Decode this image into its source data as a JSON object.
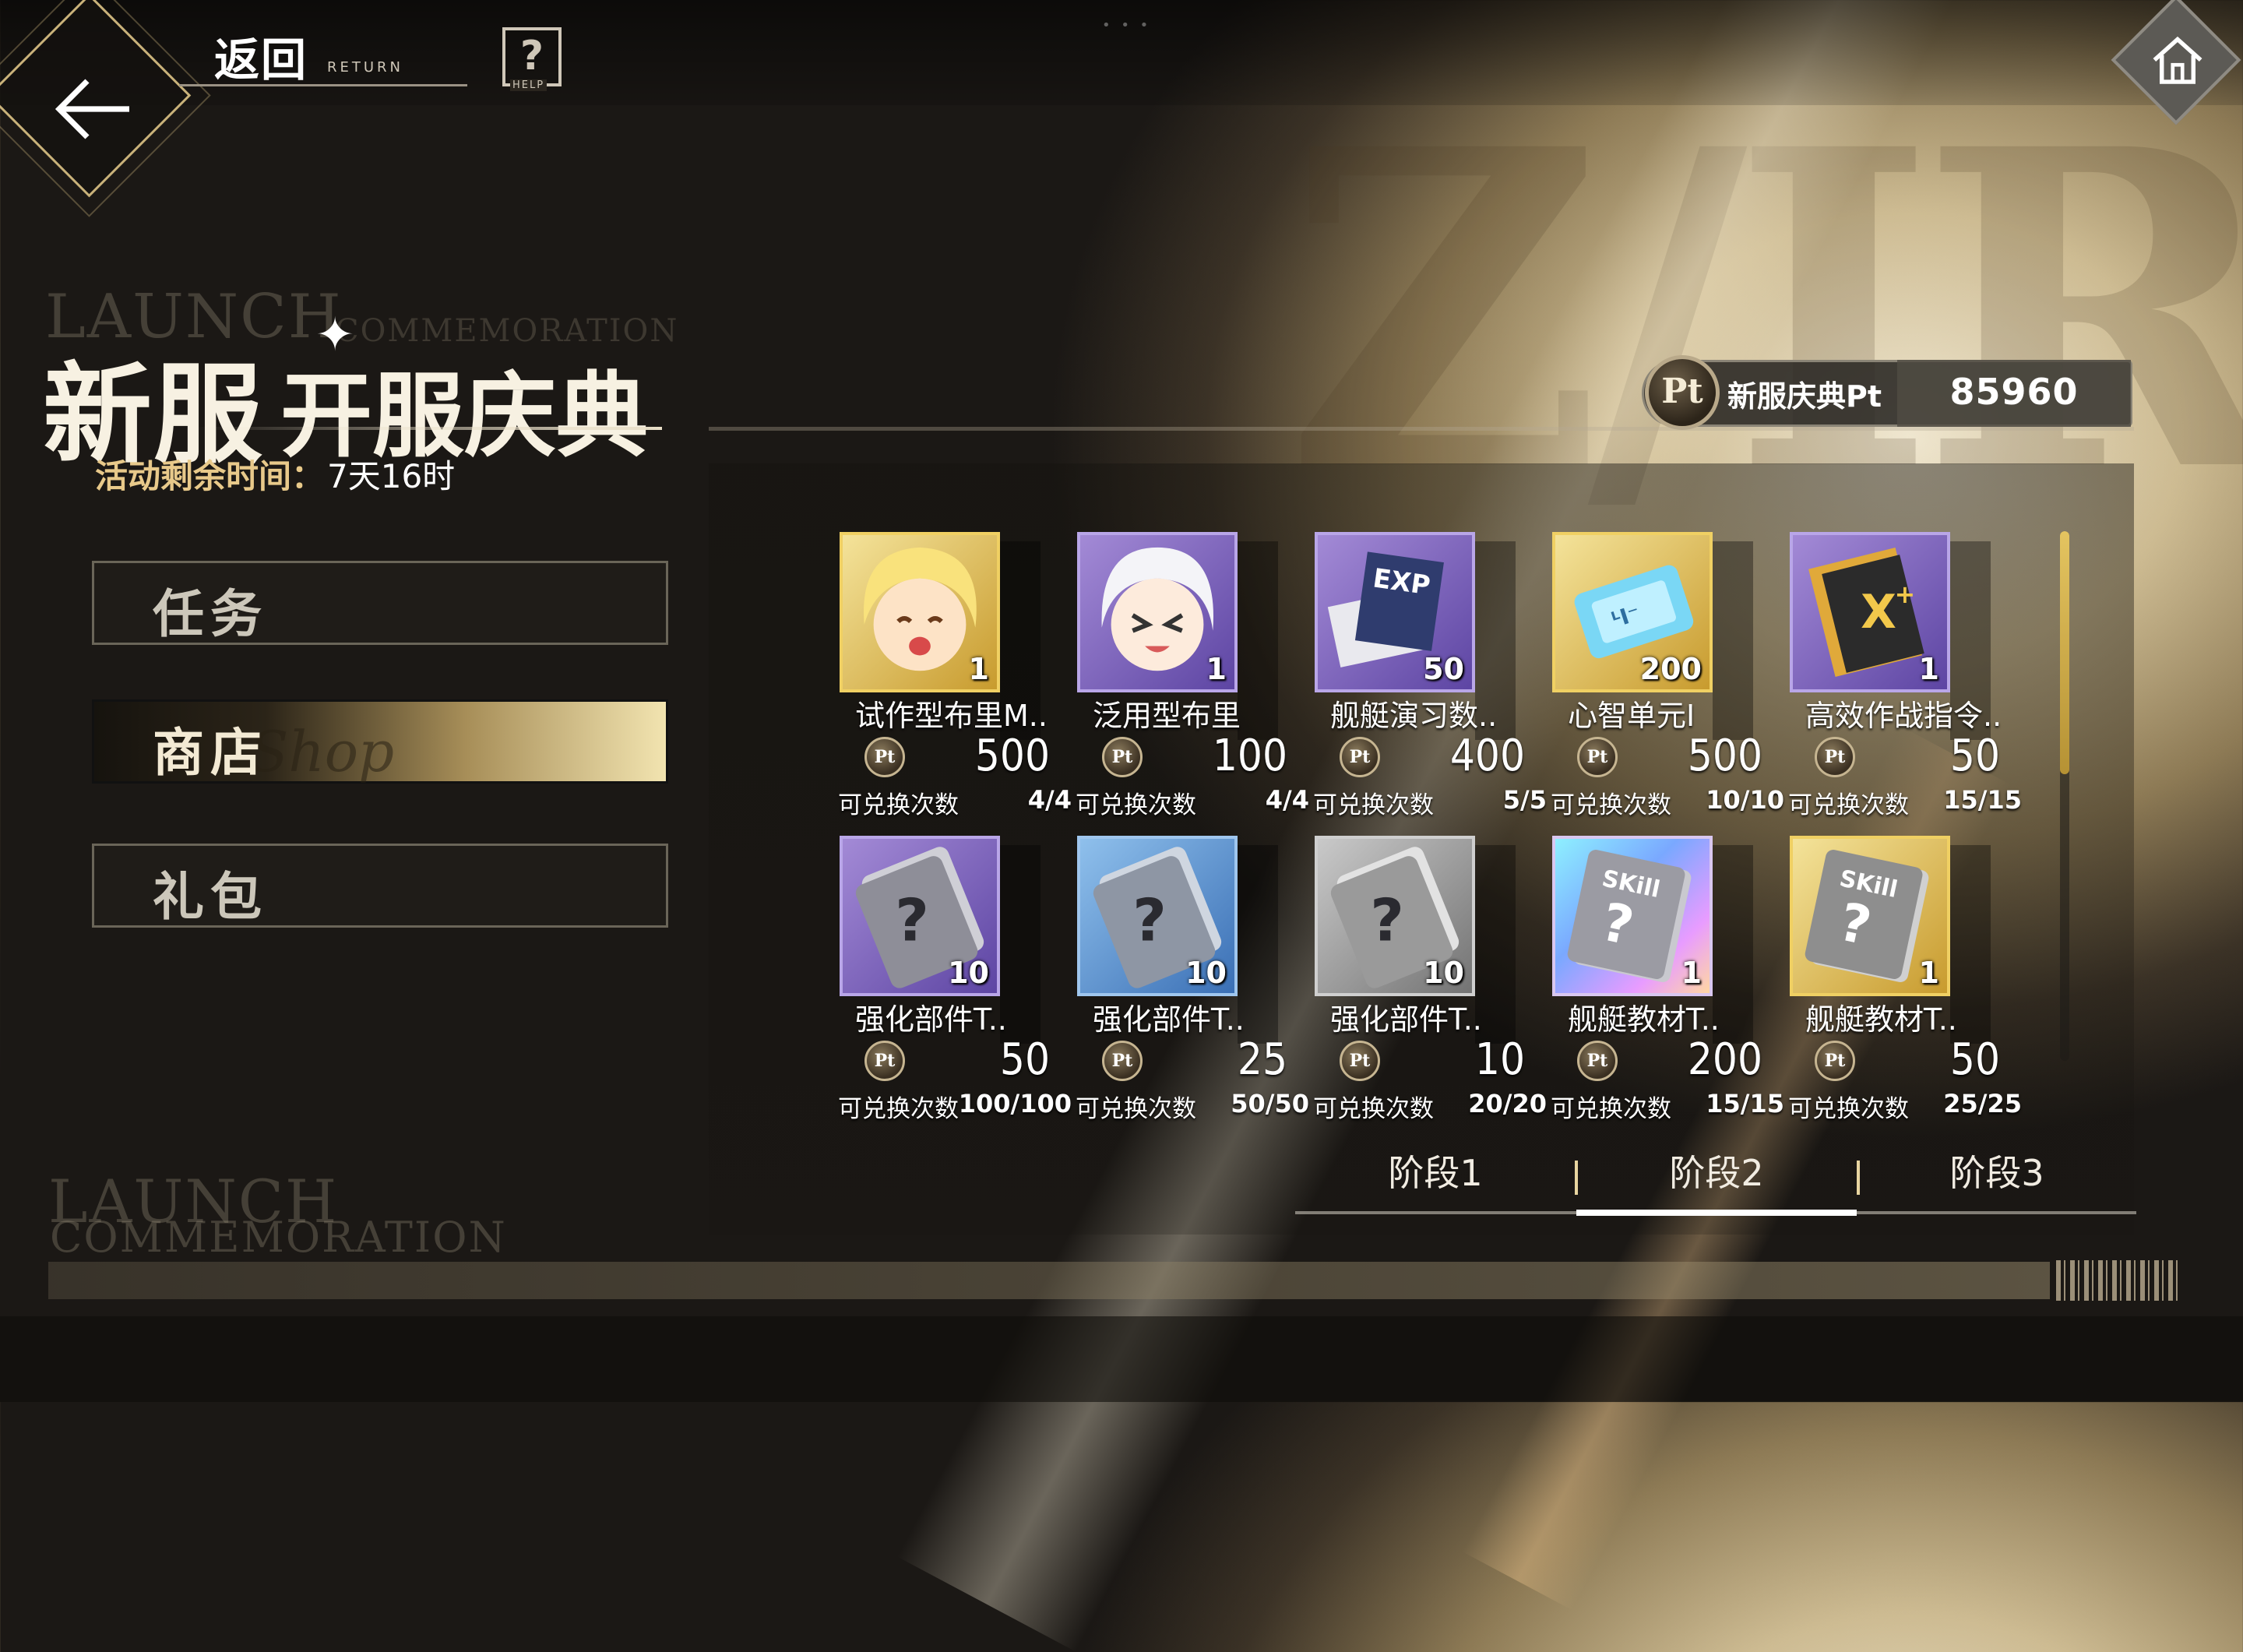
{
  "header": {
    "back_label": "返回",
    "back_sub": "RETURN",
    "help_glyph": "?",
    "help_sub": "HELP"
  },
  "event": {
    "title_bg_line1": "LAUNCH",
    "title_bg_line2": "COMMEMORATION",
    "title_main": "新服",
    "title_sub": "开服庆典",
    "remaining_label": "活动剩余时间：",
    "remaining_value": "7天16时"
  },
  "nav": {
    "items": [
      {
        "label": "任务",
        "active": false
      },
      {
        "label": "商店",
        "active": true,
        "deco": "Shop"
      },
      {
        "label": "礼包",
        "active": false
      }
    ]
  },
  "currency": {
    "coin_glyph": "Pt",
    "label": "新服庆典Pt",
    "value": "85960"
  },
  "shop": {
    "exchange_label": "可兑换次数",
    "items": [
      {
        "name": "试作型布里M..",
        "qty": "1",
        "price": "500",
        "count": "4/4",
        "rarity": "gold",
        "icon": "character-portrait-icon"
      },
      {
        "name": "泛用型布里",
        "qty": "1",
        "price": "100",
        "count": "4/4",
        "rarity": "purple",
        "icon": "character-portrait-icon"
      },
      {
        "name": "舰艇演习数..",
        "qty": "50",
        "price": "400",
        "count": "5/5",
        "rarity": "purple",
        "icon": "exp-book-icon"
      },
      {
        "name": "心智单元I",
        "qty": "200",
        "price": "500",
        "count": "10/10",
        "rarity": "gold",
        "icon": "mind-unit-chip-icon"
      },
      {
        "name": "高效作战指令..",
        "qty": "1",
        "price": "50",
        "count": "15/15",
        "rarity": "purple",
        "icon": "command-book-icon"
      },
      {
        "name": "强化部件T..",
        "qty": "10",
        "price": "50",
        "count": "100/100",
        "rarity": "purple",
        "icon": "upgrade-part-book-icon"
      },
      {
        "name": "强化部件T..",
        "qty": "10",
        "price": "25",
        "count": "50/50",
        "rarity": "blue",
        "icon": "upgrade-part-book-icon"
      },
      {
        "name": "强化部件T..",
        "qty": "10",
        "price": "10",
        "count": "20/20",
        "rarity": "gray",
        "icon": "upgrade-part-book-icon"
      },
      {
        "name": "舰艇教材T..",
        "qty": "1",
        "price": "200",
        "count": "15/15",
        "rarity": "rainbow",
        "icon": "skill-book-icon"
      },
      {
        "name": "舰艇教材T..",
        "qty": "1",
        "price": "50",
        "count": "25/25",
        "rarity": "gold",
        "icon": "skill-book-icon"
      }
    ]
  },
  "stages": {
    "items": [
      {
        "label": "阶段1",
        "active": false
      },
      {
        "label": "阶段2",
        "active": true
      },
      {
        "label": "阶段3",
        "active": false
      }
    ]
  },
  "footer": {
    "line1": "LAUNCH",
    "line2": "COMMEMORATION"
  }
}
